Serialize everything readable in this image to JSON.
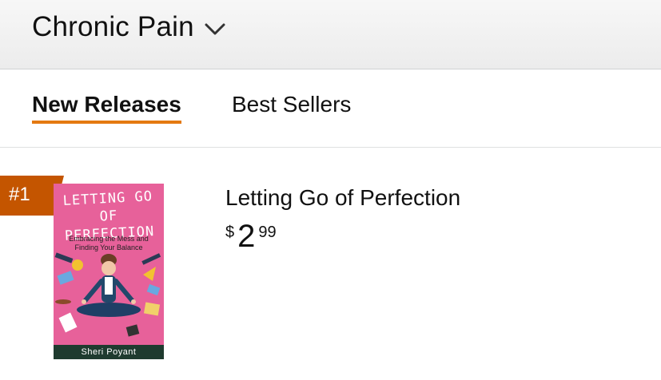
{
  "header": {
    "category_title": "Chronic Pain",
    "dropdown_icon": "chevron-down-icon"
  },
  "tabs": [
    {
      "label": "New Releases",
      "active": true
    },
    {
      "label": "Best Sellers",
      "active": false
    }
  ],
  "items": [
    {
      "rank": "#1",
      "title": "Letting Go of Perfection",
      "price": {
        "symbol": "$",
        "whole": "2",
        "fraction": "99"
      },
      "cover": {
        "title": "LETTING GO OF PERFECTION",
        "subtitle": "Embracing the Mess and Finding Your Balance",
        "author": "Sheri Poyant",
        "background_color": "#e7619a"
      }
    }
  ],
  "colors": {
    "accent": "#e47911",
    "rank_badge": "#c45500"
  }
}
